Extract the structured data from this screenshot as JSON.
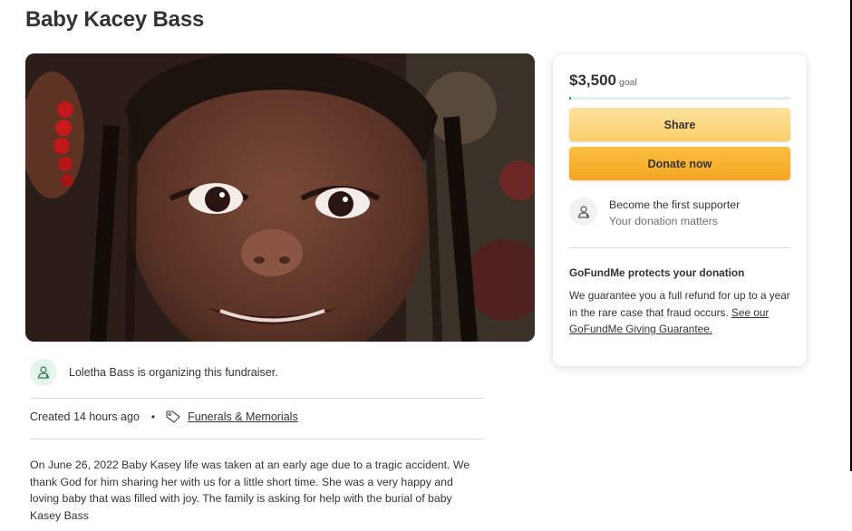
{
  "page": {
    "title": "Baby Kacey Bass"
  },
  "organizer": {
    "text": "Loletha Bass is organizing this fundraiser.",
    "icon": "user-icon"
  },
  "meta": {
    "created": "Created 14 hours ago",
    "separator": "•",
    "category": "Funerals & Memorials",
    "icon": "tag-icon"
  },
  "story": "On June 26, 2022 Baby Kasey life was taken at an early age due to a tragic accident. We thank God for him sharing her with us for a little short time. She was a very happy and loving baby that was filled with joy. The family is asking for help with the burial of baby Kasey Bass",
  "donation_card": {
    "amount": "$3,500",
    "goal_label": "goal",
    "progress_fraction": 0.01,
    "share_label": "Share",
    "donate_label": "Donate now",
    "supporter_title": "Become the first supporter",
    "supporter_subtitle": "Your donation matters",
    "protect_title": "GoFundMe protects your donation",
    "protect_text": "We guarantee you a full refund for up to a year in the rare case that fraud occurs.",
    "protect_link": "See our GoFundMe Giving Guarantee."
  },
  "colors": {
    "accent_green": "#02a95c",
    "share_button": "#fbcf6a",
    "donate_button": "#f5a623"
  }
}
